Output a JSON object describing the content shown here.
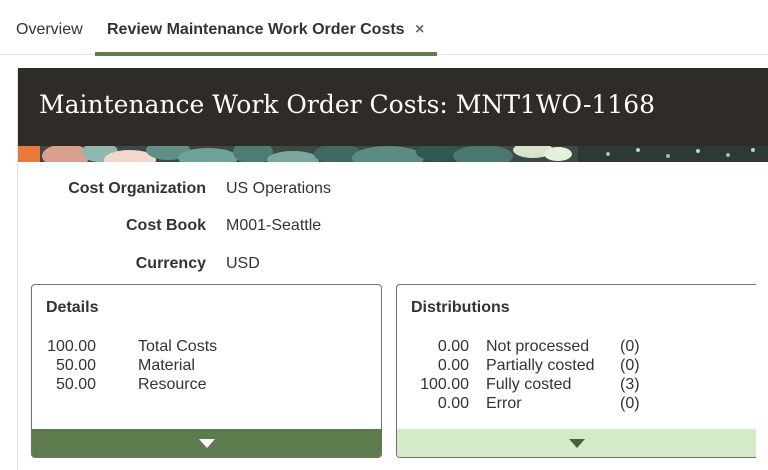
{
  "tabs": {
    "overview": "Overview",
    "active": "Review Maintenance Work Order Costs",
    "close_glyph": "×"
  },
  "header": {
    "title": "Maintenance Work Order Costs: MNT1WO-1168"
  },
  "fields": {
    "cost_org": {
      "label": "Cost Organization",
      "value": "US Operations"
    },
    "cost_book": {
      "label": "Cost Book",
      "value": "M001-Seattle"
    },
    "currency": {
      "label": "Currency",
      "value": "USD"
    }
  },
  "details": {
    "title": "Details",
    "rows": [
      {
        "amount": "100.00",
        "label": "Total Costs"
      },
      {
        "amount": "50.00",
        "label": "Material"
      },
      {
        "amount": "50.00",
        "label": "Resource"
      }
    ]
  },
  "distributions": {
    "title": "Distributions",
    "rows": [
      {
        "amount": "0.00",
        "label": "Not processed",
        "count": "(0)"
      },
      {
        "amount": "0.00",
        "label": "Partially costed",
        "count": "(0)"
      },
      {
        "amount": "100.00",
        "label": "Fully costed",
        "count": "(3)"
      },
      {
        "amount": "0.00",
        "label": "Error",
        "count": "(0)"
      }
    ]
  },
  "icons": {
    "tab_close": "close-icon",
    "expand": "chevron-down-icon"
  },
  "colors": {
    "accent_green": "#5d7b4c",
    "light_green": "#d4ebc8",
    "hero_bg": "#2f2b27"
  }
}
